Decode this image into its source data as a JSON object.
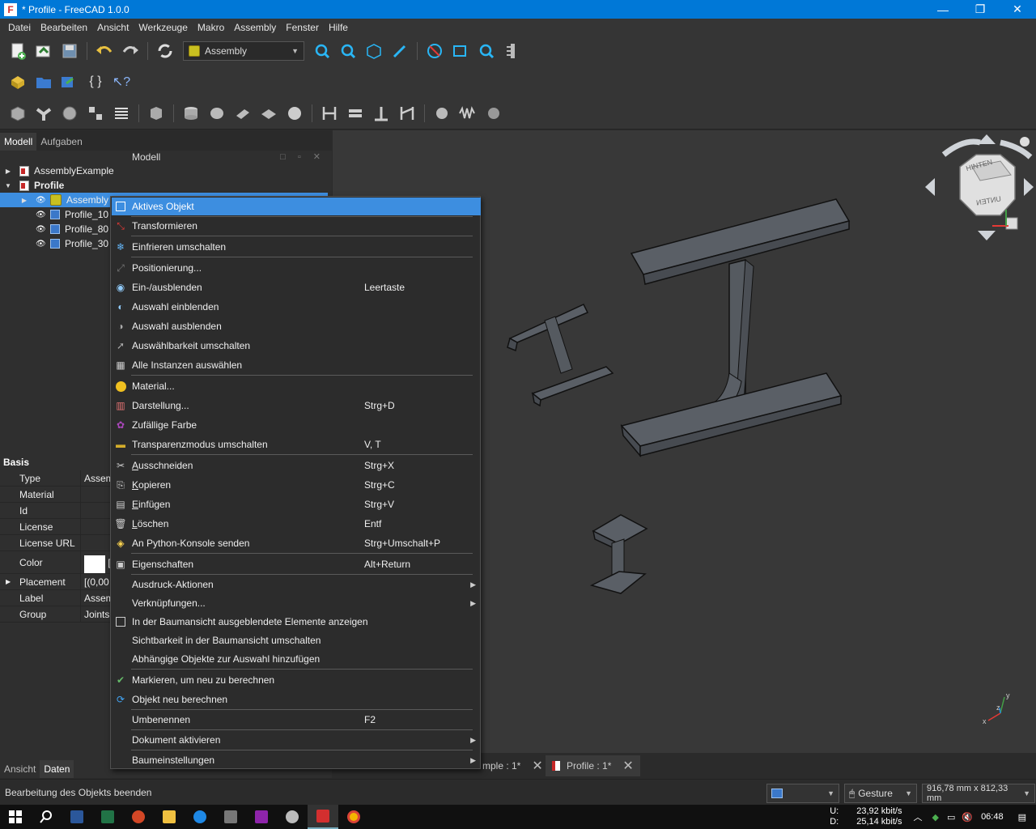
{
  "window": {
    "title": "* Profile - FreeCAD 1.0.0",
    "app_icon": "F",
    "minimize": "—",
    "maximize": "❐",
    "close": "✕"
  },
  "menubar": [
    "Datei",
    "Bearbeiten",
    "Ansicht",
    "Werkzeuge",
    "Makro",
    "Assembly",
    "Fenster",
    "Hilfe"
  ],
  "workbench_selector": {
    "value": "Assembly"
  },
  "left_panel": {
    "tabs": [
      "Modell",
      "Aufgaben"
    ],
    "title": "Modell",
    "tree": {
      "doc1": "AssemblyExample",
      "doc2": "Profile",
      "assembly": "Assembly",
      "items": [
        "Profile_10",
        "Profile_80",
        "Profile_30"
      ]
    },
    "properties": {
      "group_header": "Basis",
      "rows": [
        {
          "key": "Type",
          "value": "Assem"
        },
        {
          "key": "Material",
          "value": ""
        },
        {
          "key": "Id",
          "value": ""
        },
        {
          "key": "License",
          "value": ""
        },
        {
          "key": "License URL",
          "value": ""
        },
        {
          "key": "Color",
          "value": "["
        },
        {
          "key": "Placement",
          "value": "[(0,00"
        },
        {
          "key": "Label",
          "value": "Assem"
        },
        {
          "key": "Group",
          "value": "Joints"
        }
      ]
    },
    "bottom_tabs": [
      "Ansicht",
      "Daten"
    ]
  },
  "context_menu": {
    "items": [
      {
        "label": "Aktives Objekt",
        "shortcut": ""
      },
      {
        "label": "Transformieren",
        "shortcut": ""
      },
      {
        "label": "Einfrieren umschalten",
        "shortcut": ""
      },
      {
        "label": "Positionierung...",
        "shortcut": ""
      },
      {
        "label": "Ein-/ausblenden",
        "shortcut": "Leertaste"
      },
      {
        "label": "Auswahl einblenden",
        "shortcut": ""
      },
      {
        "label": "Auswahl ausblenden",
        "shortcut": ""
      },
      {
        "label": "Auswählbarkeit umschalten",
        "shortcut": ""
      },
      {
        "label": "Alle Instanzen auswählen",
        "shortcut": ""
      },
      {
        "label": "Material...",
        "shortcut": ""
      },
      {
        "label": "Darstellung...",
        "shortcut": "Strg+D"
      },
      {
        "label": "Zufällige Farbe",
        "shortcut": ""
      },
      {
        "label": "Transparenzmodus umschalten",
        "shortcut": "V, T"
      },
      {
        "label": "Ausschneiden",
        "shortcut": "Strg+X"
      },
      {
        "label": "Kopieren",
        "shortcut": "Strg+C"
      },
      {
        "label": "Einfügen",
        "shortcut": "Strg+V"
      },
      {
        "label": "Löschen",
        "shortcut": "Entf"
      },
      {
        "label": "An Python-Konsole senden",
        "shortcut": "Strg+Umschalt+P"
      },
      {
        "label": "Eigenschaften",
        "shortcut": "Alt+Return"
      },
      {
        "label": "Ausdruck-Aktionen",
        "shortcut": ""
      },
      {
        "label": "Verknüpfungen...",
        "shortcut": ""
      },
      {
        "label": "In der Baumansicht ausgeblendete Elemente anzeigen",
        "shortcut": ""
      },
      {
        "label": "Sichtbarkeit in der Baumansicht umschalten",
        "shortcut": ""
      },
      {
        "label": "Abhängige Objekte zur Auswahl hinzufügen",
        "shortcut": ""
      },
      {
        "label": "Markieren, um neu zu berechnen",
        "shortcut": ""
      },
      {
        "label": "Objekt neu berechnen",
        "shortcut": ""
      },
      {
        "label": "Umbenennen",
        "shortcut": "F2"
      },
      {
        "label": "Dokument aktivieren",
        "shortcut": ""
      },
      {
        "label": "Baumeinstellungen",
        "shortcut": ""
      }
    ]
  },
  "navcube": {
    "top_face": "HINTEN",
    "front_face": "UNTEN"
  },
  "axis": {
    "x": "x",
    "y": "y",
    "z": "z"
  },
  "doc_tabs": [
    {
      "label": "mple : 1*",
      "active": false
    },
    {
      "label": "Profile : 1*",
      "active": true
    }
  ],
  "statusbar": {
    "message": "Bearbeitung des Objekts beenden",
    "nav_style": "Gesture",
    "dimensions": "916,78 mm x 812,33 mm"
  },
  "taskbar": {
    "upload_label": "U:",
    "download_label": "D:",
    "upload": "23,92 kbit/s",
    "download": "25,14 kbit/s",
    "time": "06:48"
  },
  "colors": {
    "accent": "#3d8ee0",
    "titlebar": "#0078d7",
    "background": "#383838"
  }
}
